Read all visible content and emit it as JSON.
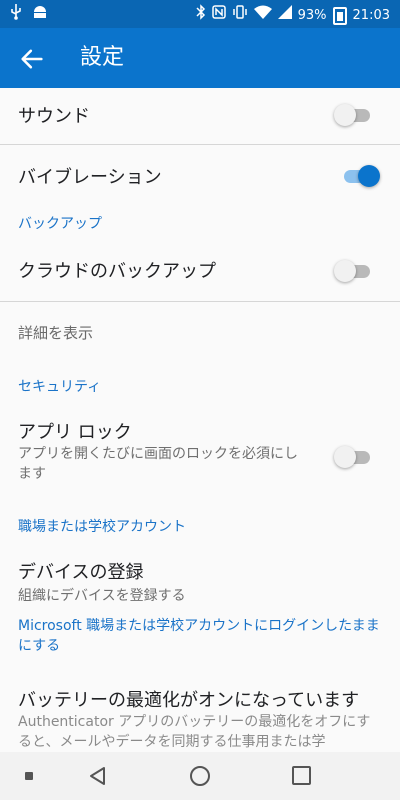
{
  "status": {
    "battery": "93%",
    "time": "21:03",
    "icons": [
      "usb-icon",
      "android-icon",
      "bluetooth-icon",
      "nfc-icon",
      "vibrate-icon",
      "wifi-icon",
      "signal-icon",
      "battery-icon"
    ]
  },
  "appbar": {
    "title": "設定"
  },
  "settings": {
    "sound": {
      "label": "サウンド",
      "on": false
    },
    "vibration": {
      "label": "バイブレーション",
      "on": true
    },
    "backup_header": "バックアップ",
    "cloud_backup": {
      "label": "クラウドのバックアップ",
      "on": false
    },
    "show_details": "詳細を表示",
    "security_header": "セキュリティ",
    "app_lock": {
      "label": "アプリ ロック",
      "sub": "アプリを開くたびに画面のロックを必須にします",
      "on": false
    },
    "work_header": "職場または学校アカウント",
    "device_register": {
      "label": "デバイスの登録",
      "sub": "組織にデバイスを登録する"
    },
    "ms_header": "Microsoft 職場または学校アカウントにログインしたままにする",
    "battery_opt": {
      "label": "バッテリーの最適化がオンになっています",
      "sub": "Authenticator アプリのバッテリーの最適化をオフにすると、メールやデータを同期する仕事用または学"
    }
  },
  "colors": {
    "primary": "#0b74cc",
    "statusbar": "#0a66b3",
    "accent": "#1a73c8"
  }
}
